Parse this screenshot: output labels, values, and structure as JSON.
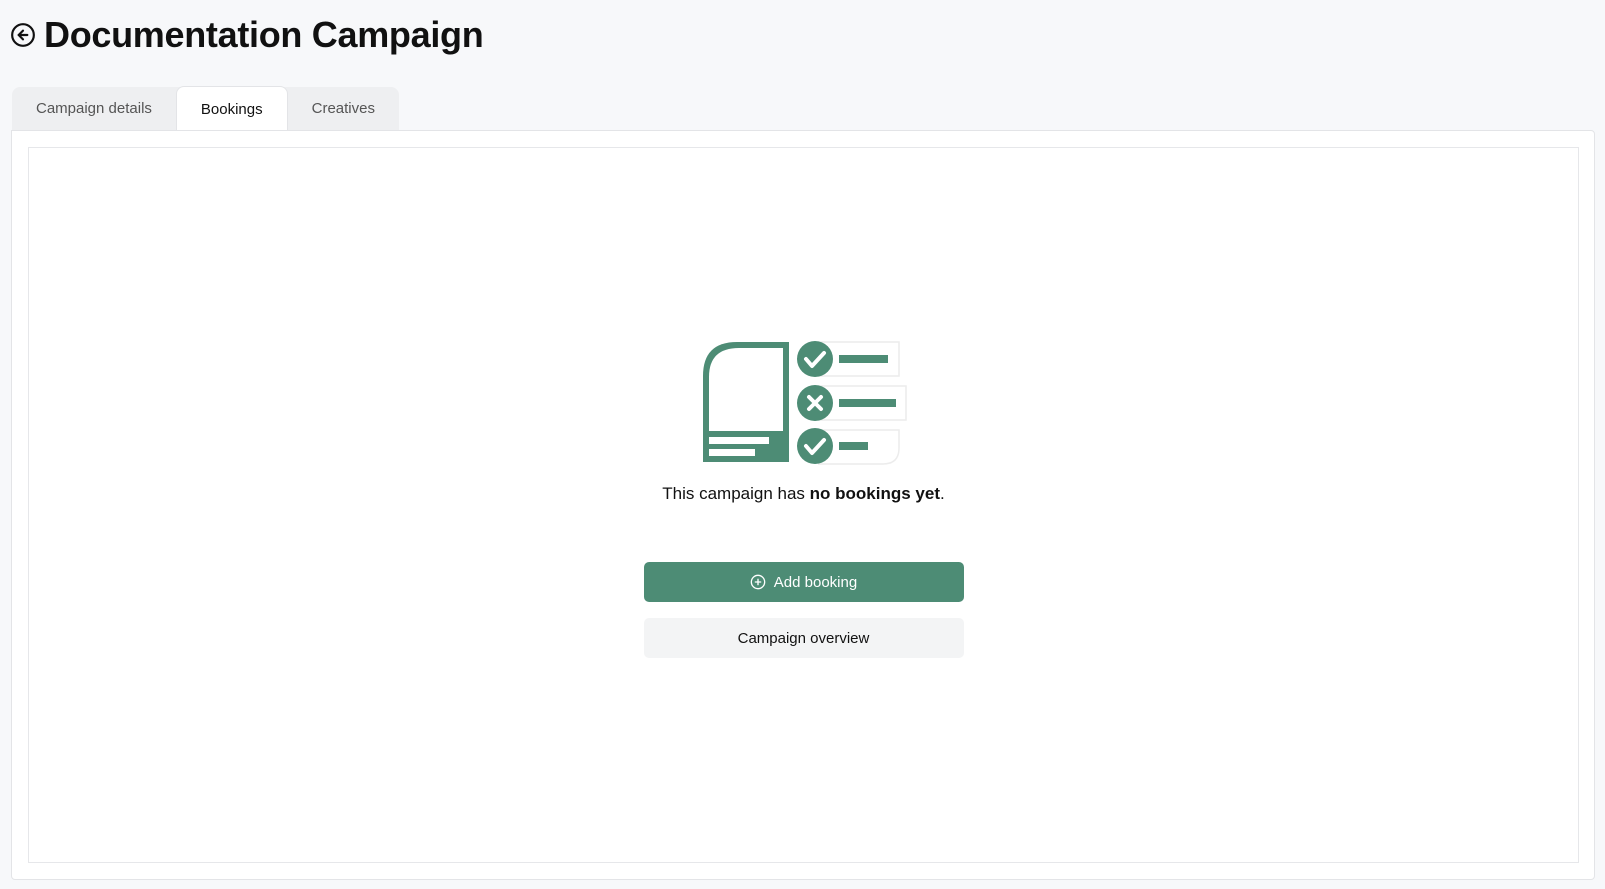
{
  "header": {
    "title": "Documentation Campaign",
    "back_icon": "arrow-left-circle-icon"
  },
  "tabs": [
    {
      "label": "Campaign details",
      "active": false
    },
    {
      "label": "Bookings",
      "active": true
    },
    {
      "label": "Creatives",
      "active": false
    }
  ],
  "empty_state": {
    "illustration_icon": "booking-checklist-illustration",
    "message_prefix": "This campaign has ",
    "message_bold": "no bookings yet",
    "message_suffix": "."
  },
  "actions": {
    "add_booking_label": "Add booking",
    "add_booking_icon": "plus-circle-icon",
    "overview_label": "Campaign overview"
  },
  "colors": {
    "accent": "#4d8c75",
    "background": "#f7f8fa",
    "panel": "#ffffff",
    "secondary_button": "#f3f4f5"
  }
}
